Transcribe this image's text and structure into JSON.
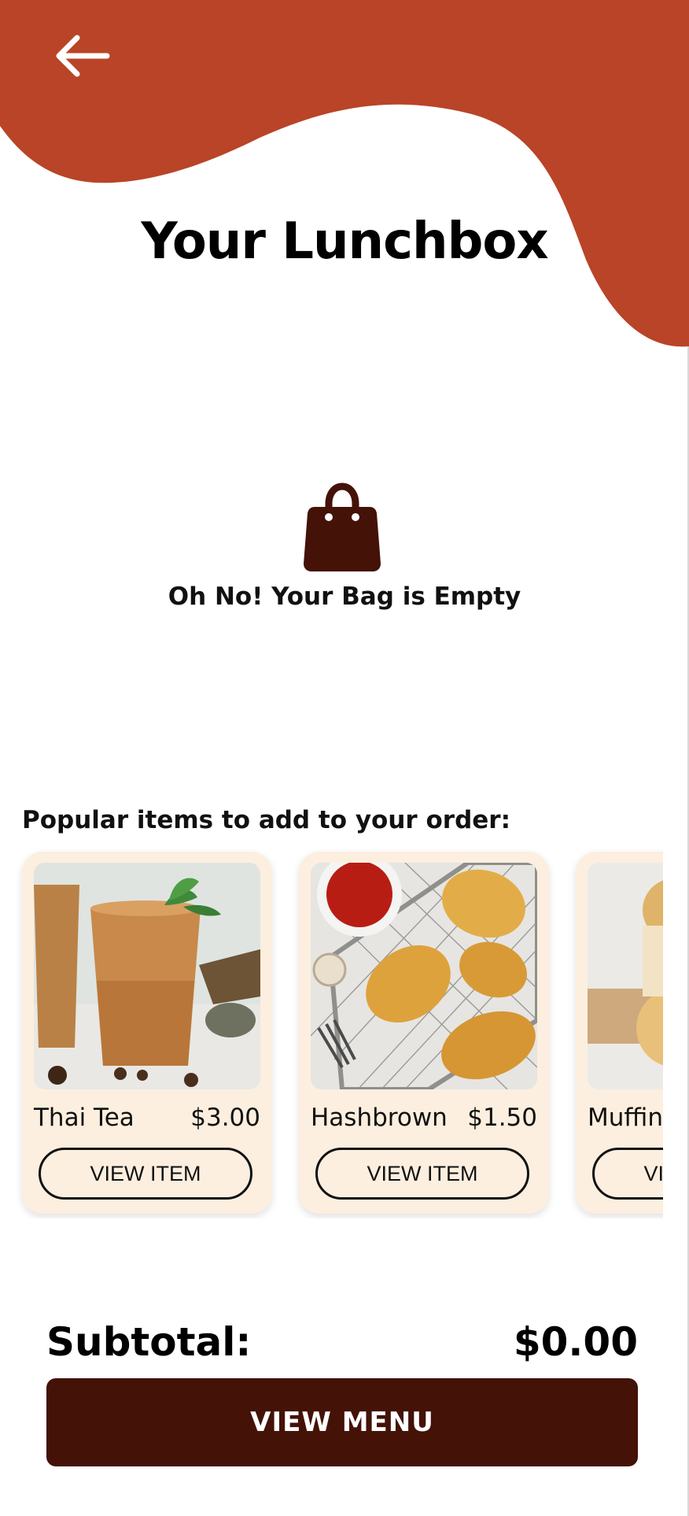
{
  "header": {
    "back_icon": "arrow-left-icon",
    "title": "Your Lunchbox"
  },
  "empty_state": {
    "icon": "shopping-bag-icon",
    "message": "Oh No! Your Bag is Empty"
  },
  "popular": {
    "heading": "Popular items to add to your order:",
    "items": [
      {
        "name": "Thai Tea",
        "price": "$3.00",
        "button": "VIEW ITEM",
        "image": "thai-tea-photo"
      },
      {
        "name": "Hashbrown",
        "price": "$1.50",
        "button": "VIEW ITEM",
        "image": "hashbrown-photo"
      },
      {
        "name": "Muffin",
        "price": "",
        "button": "VIEW ITEM",
        "image": "muffin-photo"
      }
    ]
  },
  "summary": {
    "subtotal_label": "Subtotal:",
    "subtotal_value": "$0.00"
  },
  "cta": {
    "label": "VIEW MENU"
  },
  "colors": {
    "header_wave": "#b94427",
    "primary_dark": "#441207",
    "card_background": "#fcefdf"
  }
}
